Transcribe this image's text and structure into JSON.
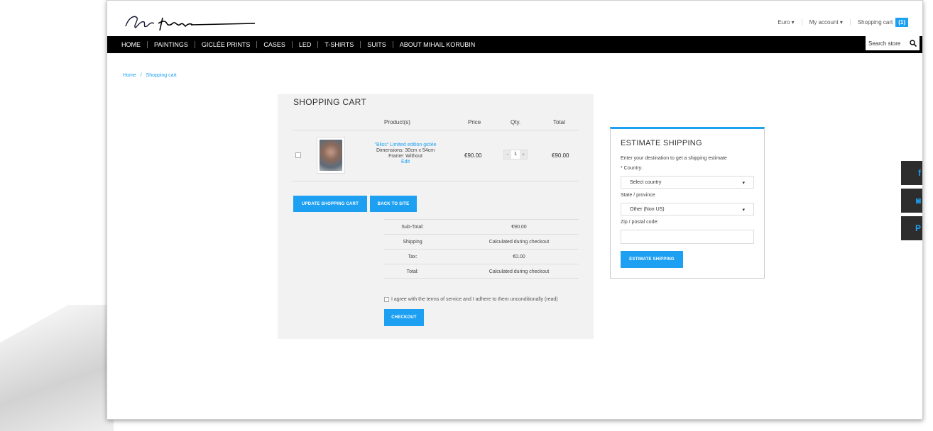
{
  "header": {
    "brand": "Mihail Korubin",
    "currency": "Euro",
    "account": "My account",
    "cart_label": "Shopping cart",
    "cart_count": "(1)"
  },
  "nav": {
    "items": [
      "HOME",
      "PAINTINGS",
      "GICLÉE PRINTS",
      "CASES",
      "LED",
      "T-SHIRTS",
      "SUITS",
      "ABOUT MIHAIL KORUBIN"
    ],
    "search_placeholder": "Search store"
  },
  "breadcrumb": {
    "home": "Home",
    "sep": "/",
    "current": "Shopping cart"
  },
  "cart": {
    "title": "SHOPPING CART",
    "columns": {
      "product": "Product(s)",
      "price": "Price",
      "qty": "Qty.",
      "total": "Total"
    },
    "item": {
      "name": "\"Bliss\" Limited edition giclée",
      "dimensions": "Dimensions: 30cm x 54cm",
      "frame": "Frame: Without",
      "edit": "Edit",
      "price": "€90.00",
      "qty": "1",
      "total": "€90.00"
    },
    "update_button": "UPDATE SHOPPING CART",
    "back_button": "BACK TO SITE",
    "totals": [
      {
        "label": "Sub-Total:",
        "value": "€90.00"
      },
      {
        "label": "Shipping",
        "value": "Calculated during checkout"
      },
      {
        "label": "Tax:",
        "value": "€0.00"
      },
      {
        "label": "Total:",
        "value": "Calculated during checkout"
      }
    ],
    "terms_text": "I agree with the terms of service and I adhere to them unconditionally (read)",
    "checkout_button": "CHECKOUT"
  },
  "shipping": {
    "title": "ESTIMATE SHIPPING",
    "intro": "Enter your destination to get a shipping estimate",
    "country_label": "* Country:",
    "country_value": "Select country",
    "state_label": "State / province",
    "state_value": "Other (Non US)",
    "zip_label": "Zip / postal code:",
    "button": "ESTIMATE SHIPPING"
  },
  "social": {
    "facebook": "f",
    "instagram": "◙",
    "pinterest": "P"
  },
  "colors": {
    "accent": "#1ea0f2",
    "nav_bg": "#000000",
    "panel_bg": "#f2f2f2"
  }
}
